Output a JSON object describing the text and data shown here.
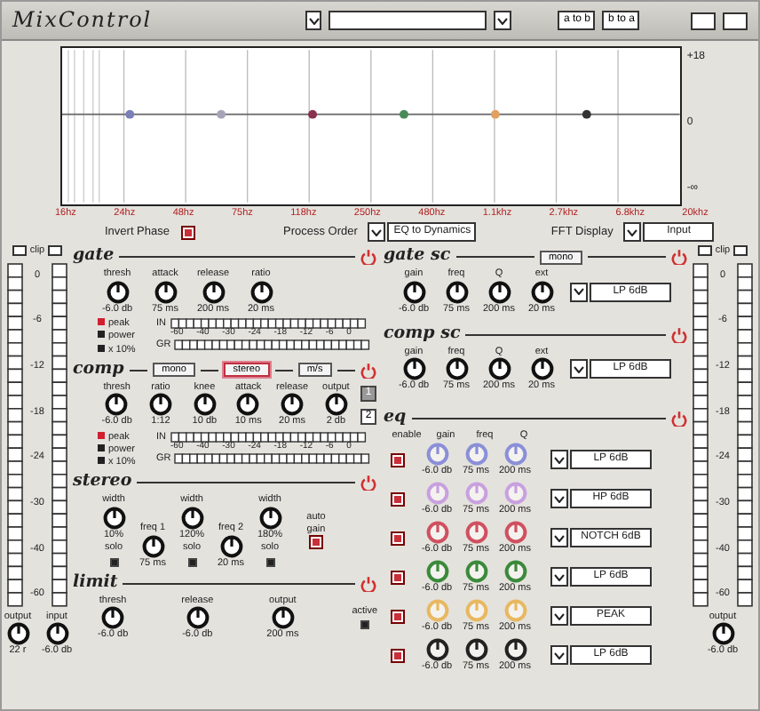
{
  "window": {
    "title": "MixControl"
  },
  "toolbar": {
    "buttons": [
      "a to b",
      "b to a"
    ]
  },
  "eq_graph": {
    "y_labels": [
      "+18",
      "0",
      "-∞"
    ],
    "freq_labels": [
      "16hz",
      "24hz",
      "48hz",
      "75hz",
      "118hz",
      "250hz",
      "480hz",
      "1.1khz",
      "2.7khz",
      "6.8khz",
      "20khz"
    ],
    "bands": [
      {
        "color": "#7a7fb8"
      },
      {
        "color": "#a8a4b8"
      },
      {
        "color": "#8a3050"
      },
      {
        "color": "#4a8a5a"
      },
      {
        "color": "#e0a060"
      },
      {
        "color": "#333333"
      }
    ]
  },
  "options": {
    "invert_phase": {
      "label": "Invert Phase",
      "checked": true
    },
    "process_order": {
      "label": "Process Order",
      "value": "EQ to Dynamics"
    },
    "fft_display": {
      "label": "FFT Display",
      "value": "Input"
    }
  },
  "meters_left": {
    "clip_label": "clip",
    "scale": [
      "0",
      "-6",
      "-12",
      "-18",
      "-24",
      "-30",
      "-40",
      "-60"
    ]
  },
  "meters_right": {
    "clip_label": "clip",
    "scale": [
      "0",
      "-6",
      "-12",
      "-18",
      "-24",
      "-30",
      "-40",
      "-60"
    ]
  },
  "io_left": [
    {
      "label": "output",
      "value": "22 r"
    },
    {
      "label": "input",
      "value": "-6.0 db"
    }
  ],
  "io_right": [
    {
      "label": "output",
      "value": "-6.0 db"
    }
  ],
  "gate": {
    "title": "gate",
    "on": true,
    "knobs": [
      {
        "label": "thresh",
        "value": "-6.0 db"
      },
      {
        "label": "attack",
        "value": "75 ms"
      },
      {
        "label": "release",
        "value": "200 ms"
      },
      {
        "label": "ratio",
        "value": "20 ms"
      }
    ],
    "legend": [
      {
        "label": "peak",
        "color": "#d02030"
      },
      {
        "label": "power",
        "color": "#222222"
      },
      {
        "label": "x 10%",
        "color": "#222222"
      }
    ],
    "meters": [
      "IN",
      "GR"
    ],
    "scale": [
      "-60",
      "-40",
      "-30",
      "-24",
      "-18",
      "-12",
      "-6",
      "0"
    ]
  },
  "comp": {
    "title": "comp",
    "on": true,
    "modes": [
      {
        "label": "mono",
        "selected": false
      },
      {
        "label": "stereo",
        "selected": true
      },
      {
        "label": "m/s",
        "selected": false
      }
    ],
    "knobs": [
      {
        "label": "thresh",
        "value": "-6.0 db"
      },
      {
        "label": "ratio",
        "value": "1:12"
      },
      {
        "label": "knee",
        "value": "10 db"
      },
      {
        "label": "attack",
        "value": "10 ms"
      },
      {
        "label": "release",
        "value": "20 ms"
      },
      {
        "label": "output",
        "value": "2 db"
      }
    ],
    "channels": [
      {
        "label": "1",
        "selected": true
      },
      {
        "label": "2",
        "selected": false
      }
    ],
    "legend": [
      {
        "label": "peak",
        "color": "#d02030"
      },
      {
        "label": "power",
        "color": "#222222"
      },
      {
        "label": "x 10%",
        "color": "#222222"
      }
    ],
    "meters": [
      "IN",
      "GR"
    ],
    "scale": [
      "-60",
      "-40",
      "-30",
      "-24",
      "-18",
      "-12",
      "-6",
      "0"
    ]
  },
  "stereo": {
    "title": "stereo",
    "on": true,
    "widths": [
      {
        "label": "width",
        "value": "10%",
        "solo": "solo",
        "solo_checked": false
      },
      {
        "label": "width",
        "value": "120%",
        "solo": "solo",
        "solo_checked": false
      },
      {
        "label": "width",
        "value": "180%",
        "solo": "solo",
        "solo_checked": false
      }
    ],
    "crossovers": [
      {
        "label": "freq 1",
        "value": "75 ms"
      },
      {
        "label": "freq 2",
        "value": "20 ms"
      }
    ],
    "auto_gain": {
      "label": "auto gain",
      "checked": true
    }
  },
  "limit": {
    "title": "limit",
    "on": true,
    "knobs": [
      {
        "label": "thresh",
        "value": "-6.0 db"
      },
      {
        "label": "release",
        "value": "-6.0 db"
      },
      {
        "label": "output",
        "value": "200 ms"
      }
    ],
    "active": {
      "label": "active",
      "checked": false
    }
  },
  "gate_sc": {
    "title": "gate sc",
    "on": true,
    "button": "mono",
    "knobs": [
      {
        "label": "gain",
        "value": "-6.0 db"
      },
      {
        "label": "freq",
        "value": "75 ms"
      },
      {
        "label": "Q",
        "value": "200 ms"
      },
      {
        "label": "ext",
        "value": "20 ms"
      }
    ],
    "filter": "LP 6dB"
  },
  "comp_sc": {
    "title": "comp sc",
    "on": true,
    "knobs": [
      {
        "label": "gain",
        "value": "-6.0 db"
      },
      {
        "label": "freq",
        "value": "75 ms"
      },
      {
        "label": "Q",
        "value": "200 ms"
      },
      {
        "label": "ext",
        "value": "20 ms"
      }
    ],
    "filter": "LP 6dB"
  },
  "eq": {
    "title": "eq",
    "on": true,
    "columns": [
      "enable",
      "gain",
      "freq",
      "Q"
    ],
    "bands": [
      {
        "enabled": true,
        "color": "#8a8fd8",
        "values": [
          "-6.0 db",
          "75 ms",
          "200 ms"
        ],
        "filter": "LP 6dB"
      },
      {
        "enabled": true,
        "color": "#c8a0e0",
        "values": [
          "-6.0 db",
          "75 ms",
          "200 ms"
        ],
        "filter": "HP 6dB"
      },
      {
        "enabled": true,
        "color": "#d05060",
        "values": [
          "-6.0 db",
          "75 ms",
          "200 ms"
        ],
        "filter": "NOTCH 6dB"
      },
      {
        "enabled": true,
        "color": "#3a8a3a",
        "values": [
          "-6.0 db",
          "75 ms",
          "200 ms"
        ],
        "filter": "LP 6dB"
      },
      {
        "enabled": true,
        "color": "#e8b860",
        "values": [
          "-6.0 db",
          "75 ms",
          "200 ms"
        ],
        "filter": "PEAK"
      },
      {
        "enabled": true,
        "color": "#222222",
        "values": [
          "-6.0 db",
          "75 ms",
          "200 ms"
        ],
        "filter": "LP 6dB"
      }
    ]
  }
}
